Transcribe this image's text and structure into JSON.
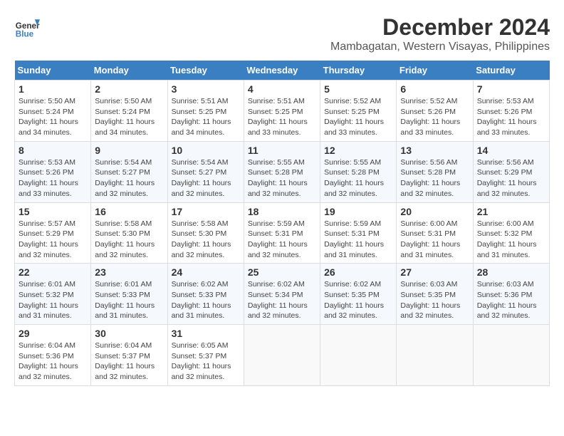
{
  "logo": {
    "line1": "General",
    "line2": "Blue"
  },
  "title": {
    "month": "December 2024",
    "location": "Mambagatan, Western Visayas, Philippines"
  },
  "weekdays": [
    "Sunday",
    "Monday",
    "Tuesday",
    "Wednesday",
    "Thursday",
    "Friday",
    "Saturday"
  ],
  "weeks": [
    [
      {
        "day": "1",
        "info": "Sunrise: 5:50 AM\nSunset: 5:24 PM\nDaylight: 11 hours\nand 34 minutes."
      },
      {
        "day": "2",
        "info": "Sunrise: 5:50 AM\nSunset: 5:24 PM\nDaylight: 11 hours\nand 34 minutes."
      },
      {
        "day": "3",
        "info": "Sunrise: 5:51 AM\nSunset: 5:25 PM\nDaylight: 11 hours\nand 34 minutes."
      },
      {
        "day": "4",
        "info": "Sunrise: 5:51 AM\nSunset: 5:25 PM\nDaylight: 11 hours\nand 33 minutes."
      },
      {
        "day": "5",
        "info": "Sunrise: 5:52 AM\nSunset: 5:25 PM\nDaylight: 11 hours\nand 33 minutes."
      },
      {
        "day": "6",
        "info": "Sunrise: 5:52 AM\nSunset: 5:26 PM\nDaylight: 11 hours\nand 33 minutes."
      },
      {
        "day": "7",
        "info": "Sunrise: 5:53 AM\nSunset: 5:26 PM\nDaylight: 11 hours\nand 33 minutes."
      }
    ],
    [
      {
        "day": "8",
        "info": "Sunrise: 5:53 AM\nSunset: 5:26 PM\nDaylight: 11 hours\nand 33 minutes."
      },
      {
        "day": "9",
        "info": "Sunrise: 5:54 AM\nSunset: 5:27 PM\nDaylight: 11 hours\nand 32 minutes."
      },
      {
        "day": "10",
        "info": "Sunrise: 5:54 AM\nSunset: 5:27 PM\nDaylight: 11 hours\nand 32 minutes."
      },
      {
        "day": "11",
        "info": "Sunrise: 5:55 AM\nSunset: 5:28 PM\nDaylight: 11 hours\nand 32 minutes."
      },
      {
        "day": "12",
        "info": "Sunrise: 5:55 AM\nSunset: 5:28 PM\nDaylight: 11 hours\nand 32 minutes."
      },
      {
        "day": "13",
        "info": "Sunrise: 5:56 AM\nSunset: 5:28 PM\nDaylight: 11 hours\nand 32 minutes."
      },
      {
        "day": "14",
        "info": "Sunrise: 5:56 AM\nSunset: 5:29 PM\nDaylight: 11 hours\nand 32 minutes."
      }
    ],
    [
      {
        "day": "15",
        "info": "Sunrise: 5:57 AM\nSunset: 5:29 PM\nDaylight: 11 hours\nand 32 minutes."
      },
      {
        "day": "16",
        "info": "Sunrise: 5:58 AM\nSunset: 5:30 PM\nDaylight: 11 hours\nand 32 minutes."
      },
      {
        "day": "17",
        "info": "Sunrise: 5:58 AM\nSunset: 5:30 PM\nDaylight: 11 hours\nand 32 minutes."
      },
      {
        "day": "18",
        "info": "Sunrise: 5:59 AM\nSunset: 5:31 PM\nDaylight: 11 hours\nand 32 minutes."
      },
      {
        "day": "19",
        "info": "Sunrise: 5:59 AM\nSunset: 5:31 PM\nDaylight: 11 hours\nand 31 minutes."
      },
      {
        "day": "20",
        "info": "Sunrise: 6:00 AM\nSunset: 5:31 PM\nDaylight: 11 hours\nand 31 minutes."
      },
      {
        "day": "21",
        "info": "Sunrise: 6:00 AM\nSunset: 5:32 PM\nDaylight: 11 hours\nand 31 minutes."
      }
    ],
    [
      {
        "day": "22",
        "info": "Sunrise: 6:01 AM\nSunset: 5:32 PM\nDaylight: 11 hours\nand 31 minutes."
      },
      {
        "day": "23",
        "info": "Sunrise: 6:01 AM\nSunset: 5:33 PM\nDaylight: 11 hours\nand 31 minutes."
      },
      {
        "day": "24",
        "info": "Sunrise: 6:02 AM\nSunset: 5:33 PM\nDaylight: 11 hours\nand 31 minutes."
      },
      {
        "day": "25",
        "info": "Sunrise: 6:02 AM\nSunset: 5:34 PM\nDaylight: 11 hours\nand 32 minutes."
      },
      {
        "day": "26",
        "info": "Sunrise: 6:02 AM\nSunset: 5:35 PM\nDaylight: 11 hours\nand 32 minutes."
      },
      {
        "day": "27",
        "info": "Sunrise: 6:03 AM\nSunset: 5:35 PM\nDaylight: 11 hours\nand 32 minutes."
      },
      {
        "day": "28",
        "info": "Sunrise: 6:03 AM\nSunset: 5:36 PM\nDaylight: 11 hours\nand 32 minutes."
      }
    ],
    [
      {
        "day": "29",
        "info": "Sunrise: 6:04 AM\nSunset: 5:36 PM\nDaylight: 11 hours\nand 32 minutes."
      },
      {
        "day": "30",
        "info": "Sunrise: 6:04 AM\nSunset: 5:37 PM\nDaylight: 11 hours\nand 32 minutes."
      },
      {
        "day": "31",
        "info": "Sunrise: 6:05 AM\nSunset: 5:37 PM\nDaylight: 11 hours\nand 32 minutes."
      },
      {
        "day": "",
        "info": ""
      },
      {
        "day": "",
        "info": ""
      },
      {
        "day": "",
        "info": ""
      },
      {
        "day": "",
        "info": ""
      }
    ]
  ]
}
